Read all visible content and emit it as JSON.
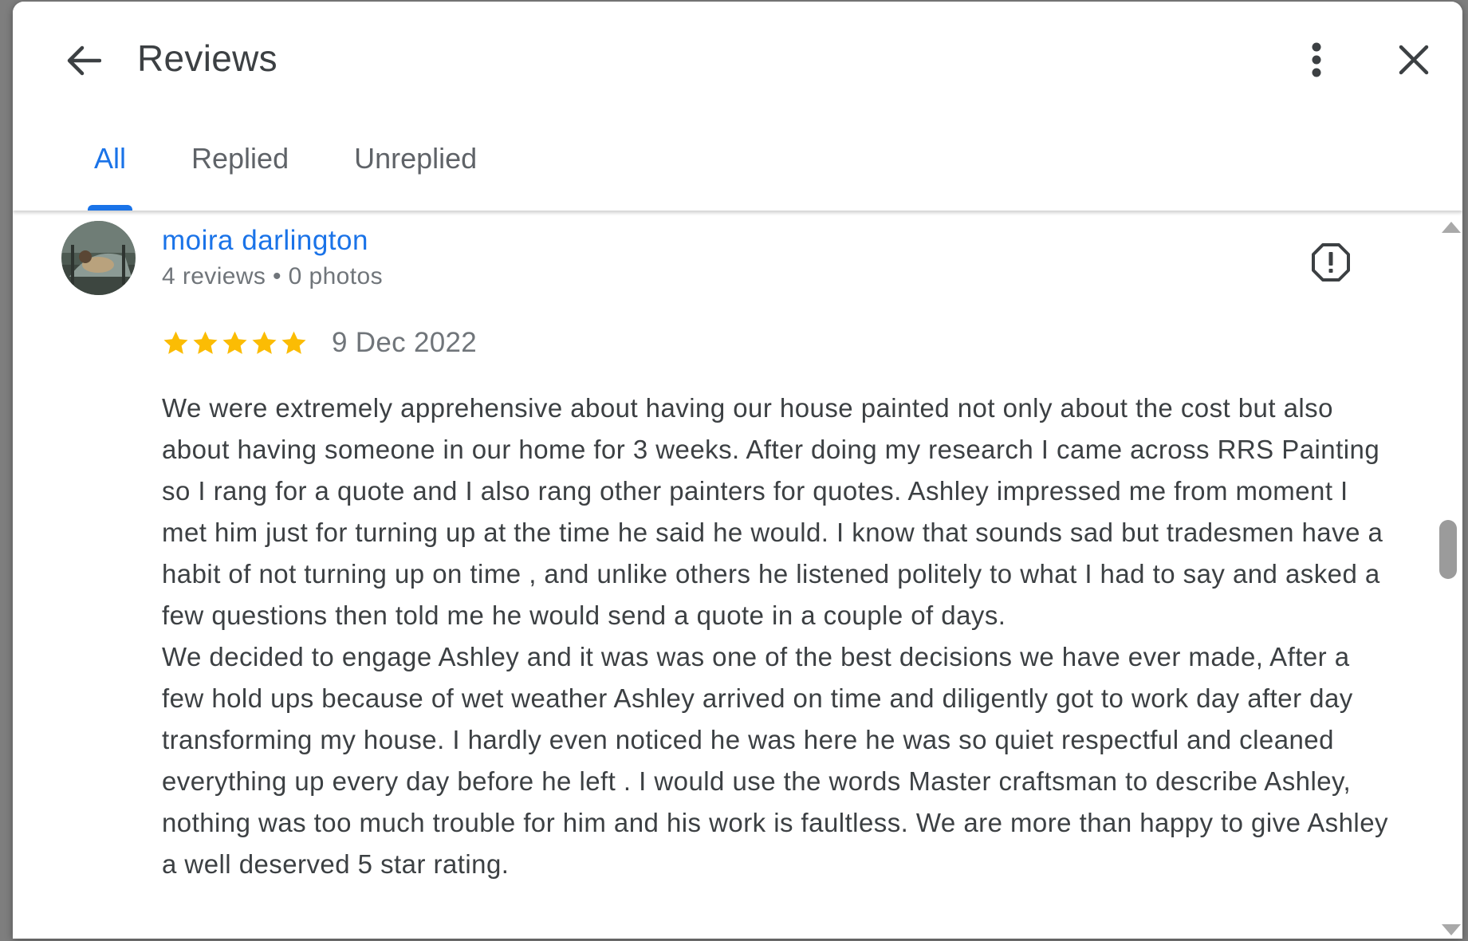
{
  "dialog": {
    "title": "Reviews",
    "back_icon": "arrow-back-icon",
    "more_icon": "more-vert-icon",
    "close_icon": "close-icon"
  },
  "tabs": [
    {
      "label": "All",
      "active": true
    },
    {
      "label": "Replied",
      "active": false
    },
    {
      "label": "Unreplied",
      "active": false
    }
  ],
  "review": {
    "reviewer_name": "moira darlington",
    "reviewer_meta": "4 reviews • 0 photos",
    "rating": 5,
    "date": "9 Dec 2022",
    "text": "We were extremely apprehensive about having our house painted not only about the cost but also about having someone in our home for 3 weeks. After doing my research I came across RRS Painting so I rang for a quote and I also rang other painters for quotes. Ashley impressed me from moment I met him just for turning up at the time he said he would. I know that sounds sad but tradesmen have a habit of not turning up on time , and unlike others he listened politely to what I had to say and asked a few questions then told me he would send a quote in a couple of days.\nWe decided to engage Ashley and it was was one of the best decisions we have ever made, After a few hold ups because of wet weather Ashley arrived on time and diligently got to work day after day transforming my house. I hardly even noticed he was here he was so quiet respectful and cleaned everything up every day before he left . I would use the words Master craftsman to describe Ashley, nothing was too much trouble for him and his work is faultless. We are more than happy to give Ashley a well deserved 5 star rating.",
    "flag_icon": "report-icon"
  },
  "colors": {
    "accent": "#1a73e8",
    "star": "#fbbc04",
    "text": "#3c4043",
    "muted": "#70757a"
  }
}
